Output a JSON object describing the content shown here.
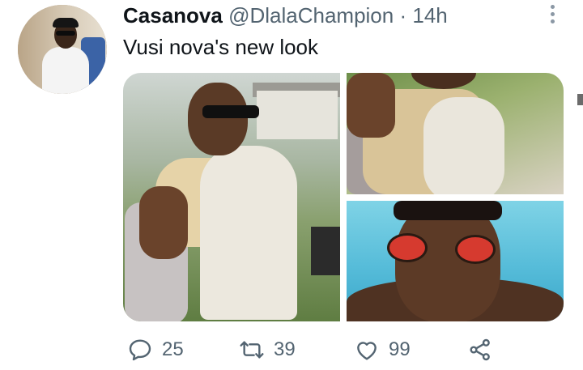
{
  "tweet": {
    "author_name": "Casanova",
    "handle": "@DlalaChampion",
    "separator": "·",
    "time": "14h",
    "text": "Vusi nova's new look",
    "media": [
      {
        "icon": "photo-man-seated-sunglasses"
      },
      {
        "icon": "photo-man-seated-closeup"
      },
      {
        "icon": "photo-man-red-sunglasses-pool"
      }
    ],
    "actions": {
      "reply_count": "25",
      "retweet_count": "39",
      "like_count": "99"
    }
  },
  "icons": {
    "reply": "speech-bubble-icon",
    "retweet": "retweet-arrows-icon",
    "like": "heart-icon",
    "share": "share-icon",
    "more": "vertical-ellipsis-icon"
  },
  "colors": {
    "text_primary": "#0f1419",
    "text_secondary": "#536471",
    "icon": "#536471"
  }
}
